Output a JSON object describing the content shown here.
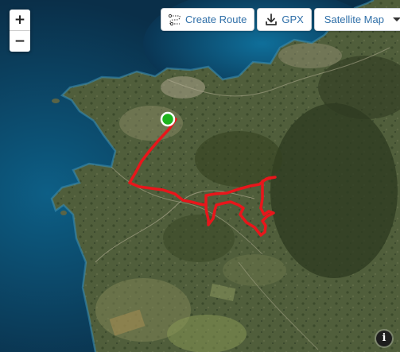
{
  "zoom": {
    "in_label": "+",
    "out_label": "−"
  },
  "toolbar": {
    "create_route_label": "Create Route",
    "gpx_label": "GPX",
    "map_type_label": "Satellite Map"
  },
  "info_label": "i",
  "icons": {
    "create_route": "route-icon",
    "gpx": "download-icon",
    "map_type": "caret-down-icon",
    "info": "info-icon"
  },
  "colors": {
    "route": "#e8161b",
    "start_marker": "#1db31d",
    "button_text": "#2f6fa8"
  }
}
